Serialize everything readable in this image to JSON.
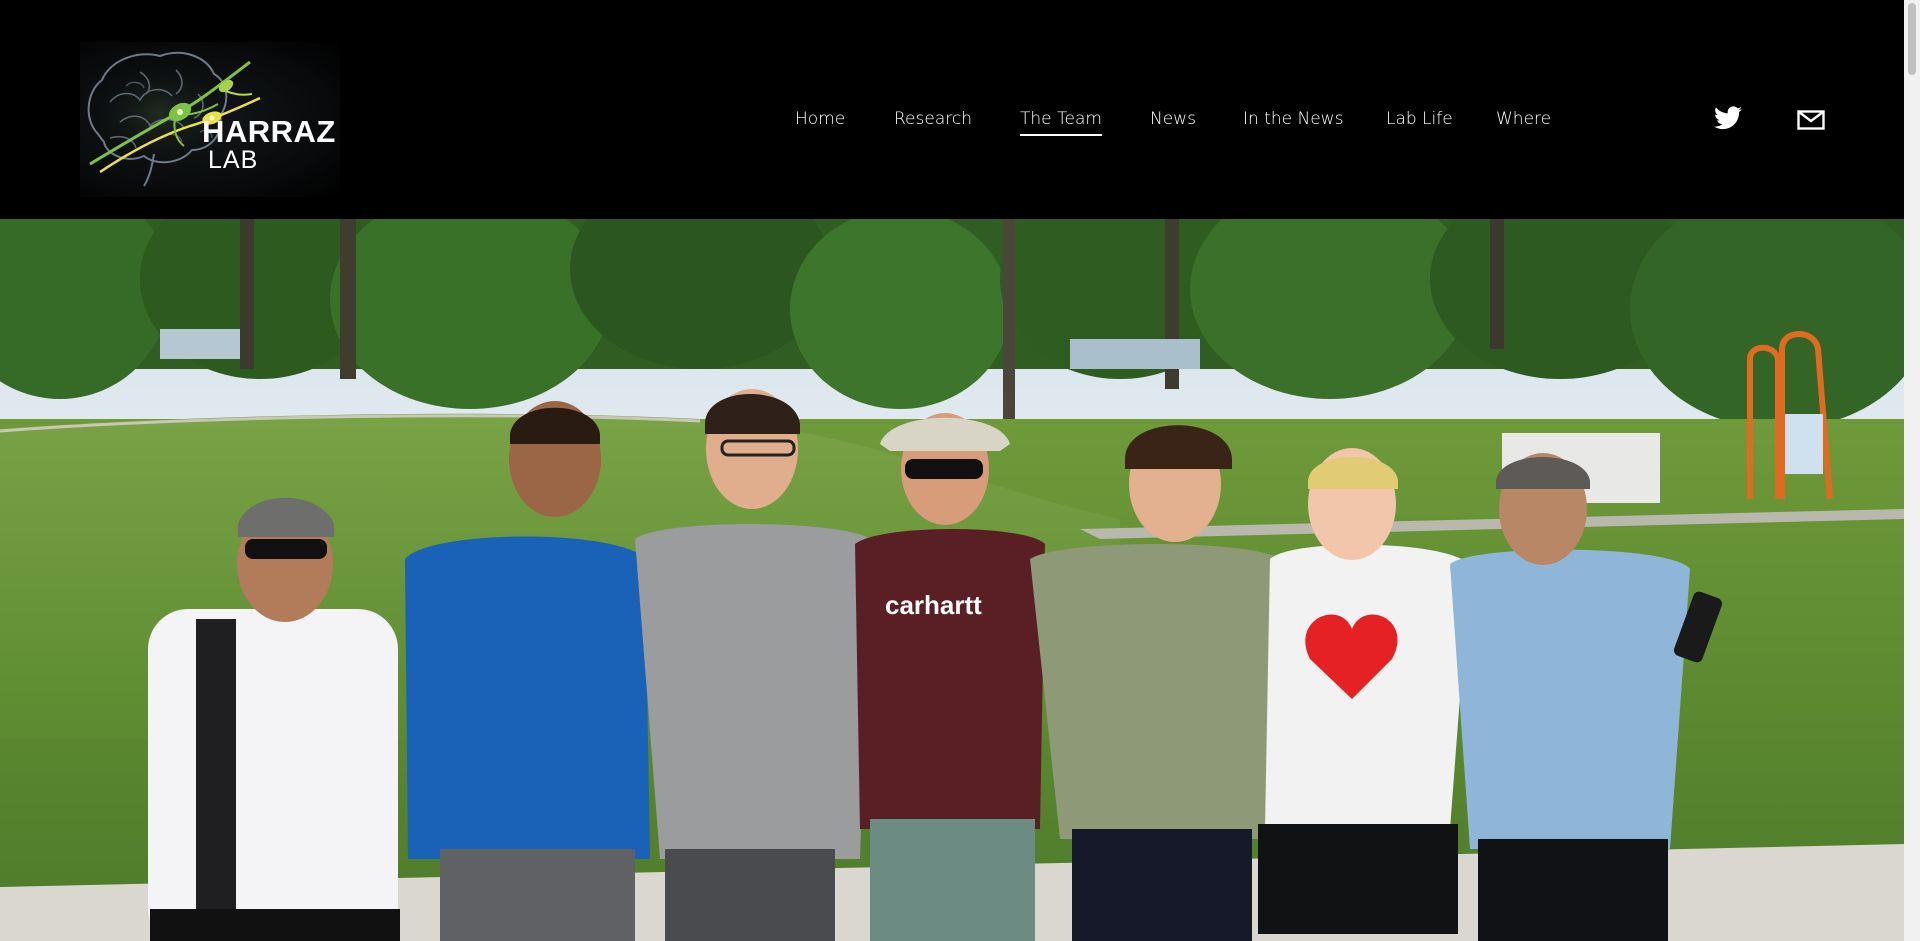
{
  "logo": {
    "line1": "HARRAZ",
    "line2": "LAB",
    "icon": "brain-neuron-icon"
  },
  "nav": {
    "items": [
      {
        "label": "Home"
      },
      {
        "label": "Research"
      },
      {
        "label": "The Team",
        "active": true
      },
      {
        "label": "News"
      },
      {
        "label": "In the News"
      },
      {
        "label": "Lab Life"
      },
      {
        "label": "Where"
      }
    ]
  },
  "social": {
    "twitter_icon": "twitter-icon",
    "email_icon": "mail-icon"
  },
  "hero": {
    "image": "team-group-photo-outdoors"
  },
  "colors": {
    "header_bg": "#000000",
    "text": "#ffffff",
    "brand_green": "#7dc242",
    "brand_yellow": "#e9e04a"
  }
}
